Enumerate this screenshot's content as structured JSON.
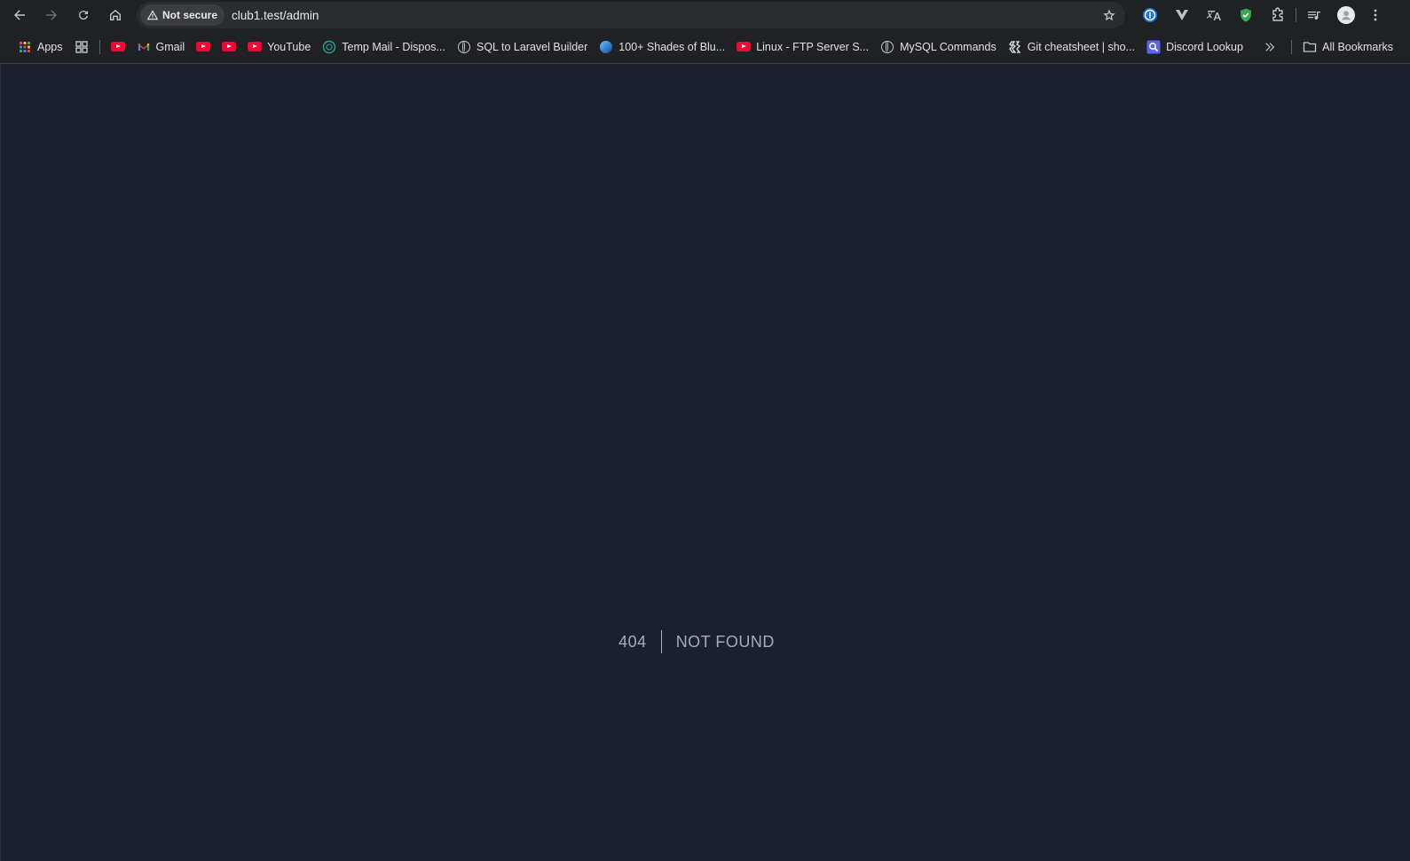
{
  "toolbar": {
    "security_label": "Not secure",
    "url": "club1.test/admin"
  },
  "bookmarks": {
    "apps": "Apps",
    "gmail": "Gmail",
    "youtube": "YouTube",
    "temp_mail": "Temp Mail - Dispos...",
    "sql_laravel": "SQL to Laravel Builder",
    "shades": "100+ Shades of Blu...",
    "linux_ftp": "Linux - FTP Server S...",
    "mysql": "MySQL Commands",
    "git": "Git cheatsheet | sho...",
    "discord": "Discord Lookup",
    "all_bookmarks": "All Bookmarks"
  },
  "error": {
    "code": "404",
    "message": "NOT FOUND"
  },
  "colors": {
    "page_bg": "#1a202c",
    "chrome_bg": "#202124",
    "error_text": "#a0aec0"
  }
}
